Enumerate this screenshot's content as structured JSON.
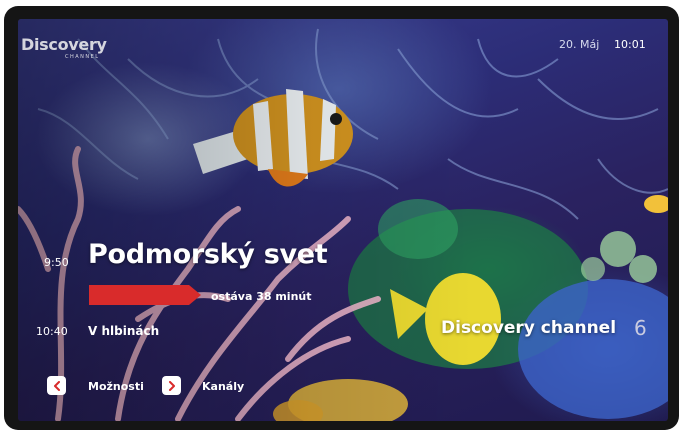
{
  "brand": {
    "logo_text": "Discovery",
    "logo_sub": "CHANNEL"
  },
  "status_bar": {
    "date": "20. Máj",
    "time": "10:01"
  },
  "now_playing": {
    "start_time": "9:50",
    "title": "Podmorský svet",
    "remaining": "ostáva 38 minút",
    "progress_color": "#d92b2b"
  },
  "up_next": {
    "start_time": "10:40",
    "title": "V hlbinách"
  },
  "channel": {
    "name": "Discovery channel",
    "number": "6"
  },
  "nav": {
    "options_label": "Možnosti",
    "channels_label": "Kanály"
  },
  "colors": {
    "accent": "#d92b2b",
    "text": "#ffffff"
  }
}
